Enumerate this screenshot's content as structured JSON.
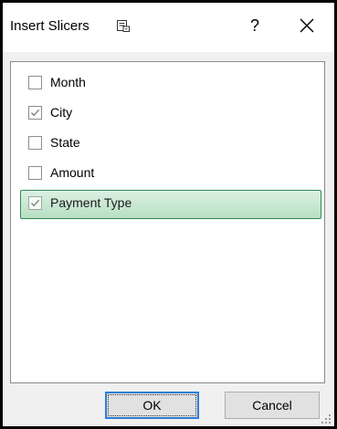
{
  "dialog": {
    "title": "Insert Slicers",
    "help_label": "?",
    "title_icon": "slicer-icon",
    "close_icon": "close-icon"
  },
  "fields": [
    {
      "label": "Month",
      "checked": false,
      "selected": false
    },
    {
      "label": "City",
      "checked": true,
      "selected": false
    },
    {
      "label": "State",
      "checked": false,
      "selected": false
    },
    {
      "label": "Amount",
      "checked": false,
      "selected": false
    },
    {
      "label": "Payment Type",
      "checked": true,
      "selected": true
    }
  ],
  "buttons": {
    "ok_label": "OK",
    "cancel_label": "Cancel"
  },
  "colors": {
    "selected_border": "#2e8a55",
    "selected_fill": "#c9e8d2",
    "default_button_border": "#2a7fd4",
    "check_color": "#7a7a7a"
  }
}
